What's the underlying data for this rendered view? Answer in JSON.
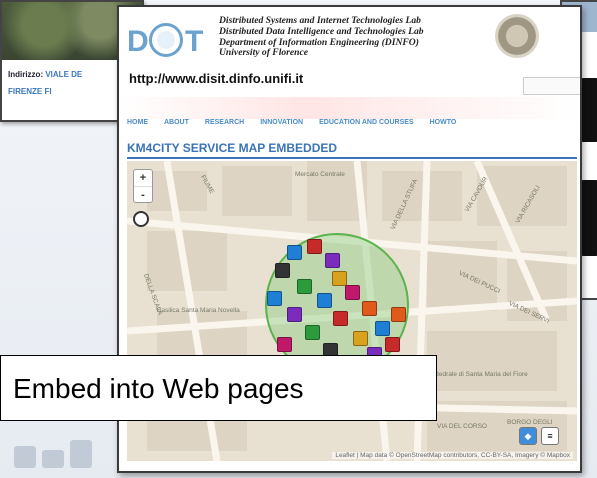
{
  "background_left": {
    "address_label": "Indirizzo:",
    "address_value": "VIALE DE",
    "city": "FIRENZE FI"
  },
  "header": {
    "logo_letters": [
      "D",
      "T"
    ],
    "org_lines": [
      "Distributed Systems and Internet Technologies Lab",
      "Distributed Data Intelligence and Technologies Lab",
      "Department of Information Engineering (DINFO)",
      "University of Florence"
    ],
    "url": "http://www.disit.dinfo.unifi.it"
  },
  "nav": {
    "items": [
      "HOME",
      "ABOUT",
      "RESEARCH",
      "INNOVATION",
      "EDUCATION AND COURSES",
      "HOWTO"
    ]
  },
  "section": {
    "title": "KM4CITY SERVICE MAP EMBEDDED"
  },
  "map": {
    "zoom_in": "+",
    "zoom_out": "-",
    "streets": [
      "Mercato Centrale",
      "VIA DELLA STUFA",
      "VIA CAVOUR",
      "VIA RICASOLI",
      "VIA DEI PUCCI",
      "VIA DEI SERVI",
      "Basilica Santa Maria Novella",
      "Cattedrale di Santa Maria del Fiore",
      "VIA DEL CORSO",
      "BORGO DEGLI",
      "FIUME",
      "DELLA SCALA"
    ],
    "attribution": "Leaflet | Map data © OpenStreetMap contributors, CC-BY-SA, Imagery © Mapbox"
  },
  "caption": {
    "text": "Embed into Web pages"
  }
}
